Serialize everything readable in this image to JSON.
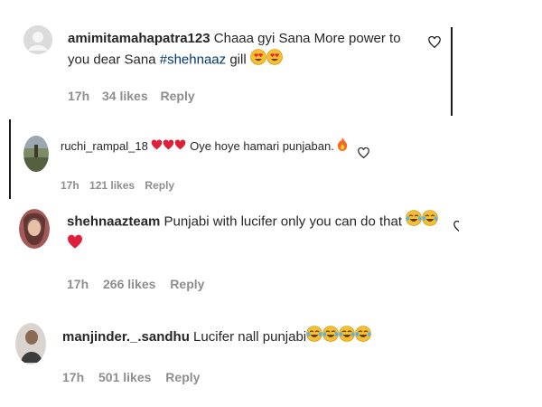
{
  "comments": [
    {
      "username": "amimitamahapatra123",
      "text": "Chaaa gyi Sana More power to you dear Sana ",
      "hashtag": "#shehnaaz",
      "text_after": " gill",
      "emojis": [
        "heart-eyes",
        "heart-eyes"
      ],
      "time": "17h",
      "likes": "34 likes",
      "reply": "Reply"
    },
    {
      "username": "ruchi_rampal_18",
      "text": "Oye hoye hamari punjaban.",
      "emojis_before": [
        "red-heart",
        "red-heart",
        "red-heart"
      ],
      "emojis_after": [
        "fire"
      ],
      "time": "17h",
      "likes": "121 likes",
      "reply": "Reply"
    },
    {
      "username": "shehnaazteam",
      "text": "Punjabi with lucifer only you can do that",
      "emojis": [
        "tears-of-joy",
        "tears-of-joy",
        "red-heart"
      ],
      "time": "17h",
      "likes": "266 likes",
      "reply": "Reply"
    },
    {
      "username": "manjinder._.sandhu",
      "text": "Lucifer nall punjabi",
      "emojis": [
        "tears-of-joy",
        "tears-of-joy",
        "tears-of-joy",
        "tears-of-joy"
      ],
      "time": "17h",
      "likes": "501 likes",
      "reply": "Reply"
    }
  ],
  "colors": {
    "username": "#262626",
    "meta": "#8e8e8e",
    "hashtag": "#00376b",
    "heart": "#e0245e"
  }
}
